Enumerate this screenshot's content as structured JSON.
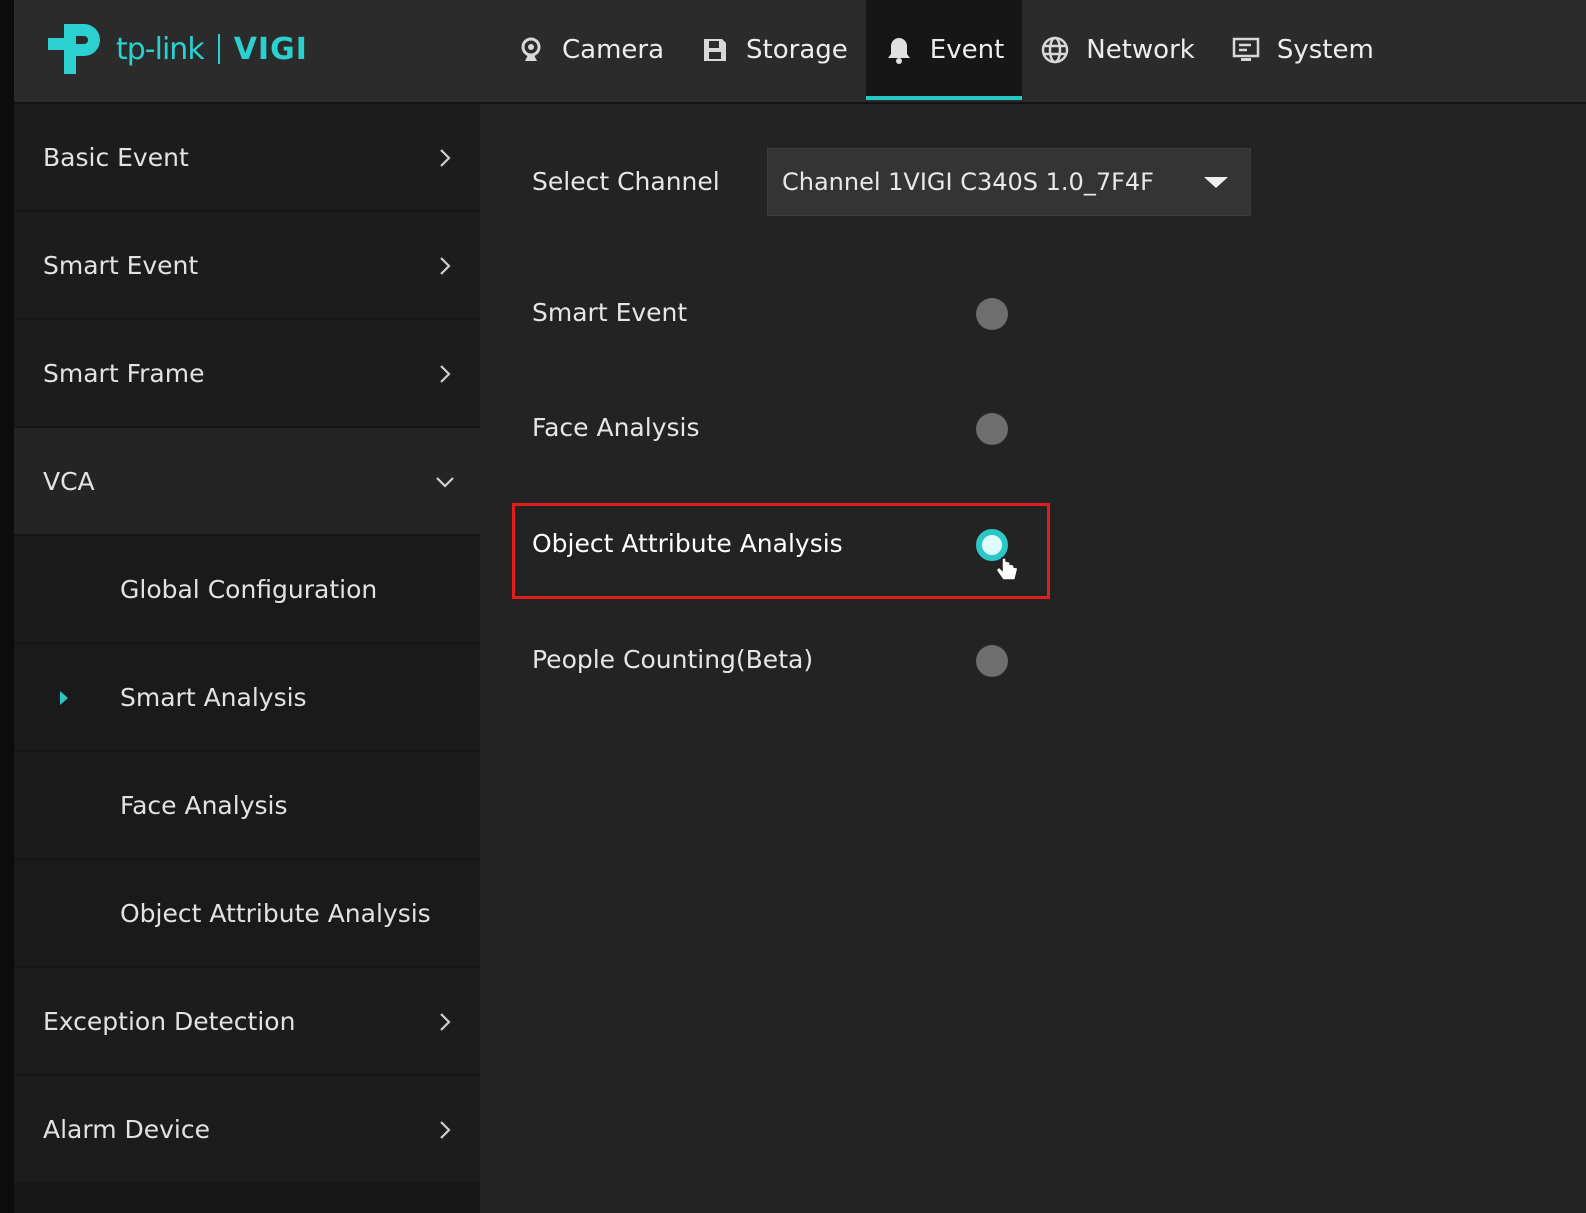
{
  "brand": {
    "tp": "tp-link",
    "vigi": "VIGI"
  },
  "nav": {
    "tabs": [
      {
        "label": "Camera",
        "icon": "camera-icon"
      },
      {
        "label": "Storage",
        "icon": "storage-icon"
      },
      {
        "label": "Event",
        "icon": "bell-icon",
        "active": true
      },
      {
        "label": "Network",
        "icon": "globe-icon"
      },
      {
        "label": "System",
        "icon": "monitor-icon"
      }
    ]
  },
  "sidebar": {
    "items": [
      {
        "label": "Basic Event"
      },
      {
        "label": "Smart Event"
      },
      {
        "label": "Smart Frame"
      },
      {
        "label": "VCA",
        "expanded": true
      },
      {
        "label": "Global Configuration"
      },
      {
        "label": "Smart Analysis",
        "selected": true
      },
      {
        "label": "Face Analysis"
      },
      {
        "label": "Object Attribute Analysis"
      },
      {
        "label": "Exception Detection"
      },
      {
        "label": "Alarm Device"
      }
    ]
  },
  "main": {
    "select_channel_label": "Select Channel",
    "channel_value": "Channel 1VIGI C340S 1.0_7F4F",
    "options": [
      {
        "label": "Smart Event",
        "selected": false
      },
      {
        "label": "Face Analysis",
        "selected": false
      },
      {
        "label": "Object Attribute Analysis",
        "selected": true
      },
      {
        "label": "People Counting(Beta)",
        "selected": false
      }
    ]
  },
  "colors": {
    "accent": "#2bc6c6",
    "highlight": "#e01e1e",
    "background": "#232323"
  }
}
